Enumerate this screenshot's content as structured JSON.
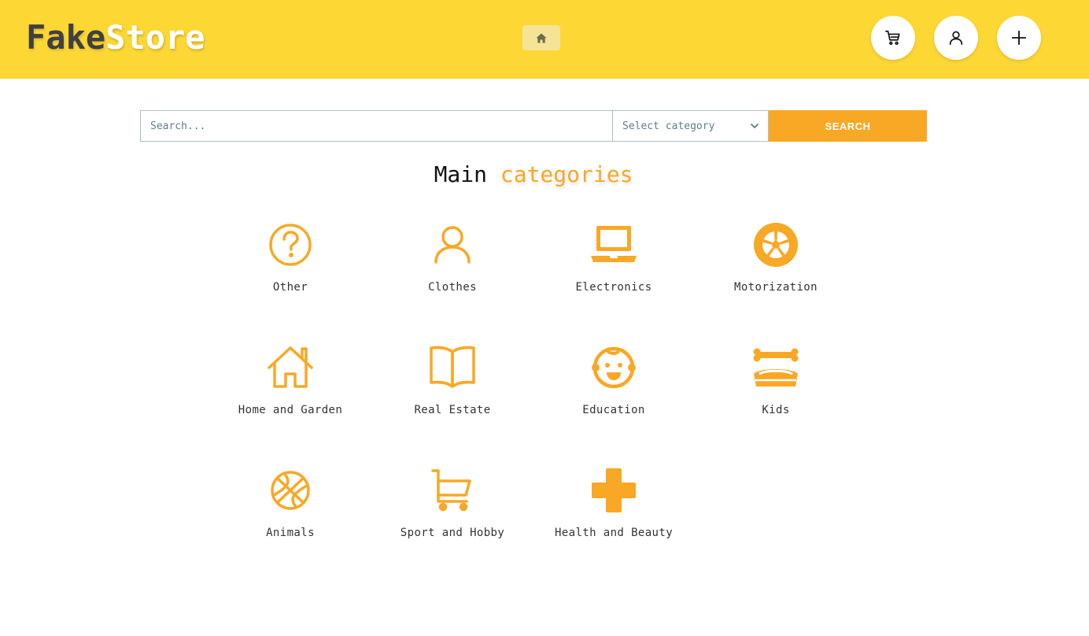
{
  "header": {
    "logo_part1": "Fake",
    "logo_part2": "Store",
    "home_icon": "home-icon",
    "buttons": [
      {
        "name": "cart",
        "icon": "cart-icon"
      },
      {
        "name": "account",
        "icon": "user-icon"
      },
      {
        "name": "add",
        "icon": "plus-icon"
      }
    ],
    "background_color": "#fdd835"
  },
  "search": {
    "placeholder": "Search...",
    "category_selected": "Select category",
    "button_label": "SEARCH",
    "accent_color": "#f9a825"
  },
  "main": {
    "title_part1": "Main",
    "title_part2": "categories",
    "categories": [
      {
        "label": "Other",
        "icon": "question-circle-icon"
      },
      {
        "label": "Clothes",
        "icon": "person-icon"
      },
      {
        "label": "Electronics",
        "icon": "laptop-icon"
      },
      {
        "label": "Motorization",
        "icon": "wheel-icon"
      },
      {
        "label": "Home and Garden",
        "icon": "house-icon"
      },
      {
        "label": "Real Estate",
        "icon": "open-book-icon"
      },
      {
        "label": "Education",
        "icon": "baby-face-icon"
      },
      {
        "label": "Kids",
        "icon": "dog-bowl-icon"
      },
      {
        "label": "Animals",
        "icon": "basketball-icon"
      },
      {
        "label": "Sport and Hobby",
        "icon": "shopping-cart-icon"
      },
      {
        "label": "Health and Beauty",
        "icon": "medical-cross-icon"
      }
    ]
  }
}
